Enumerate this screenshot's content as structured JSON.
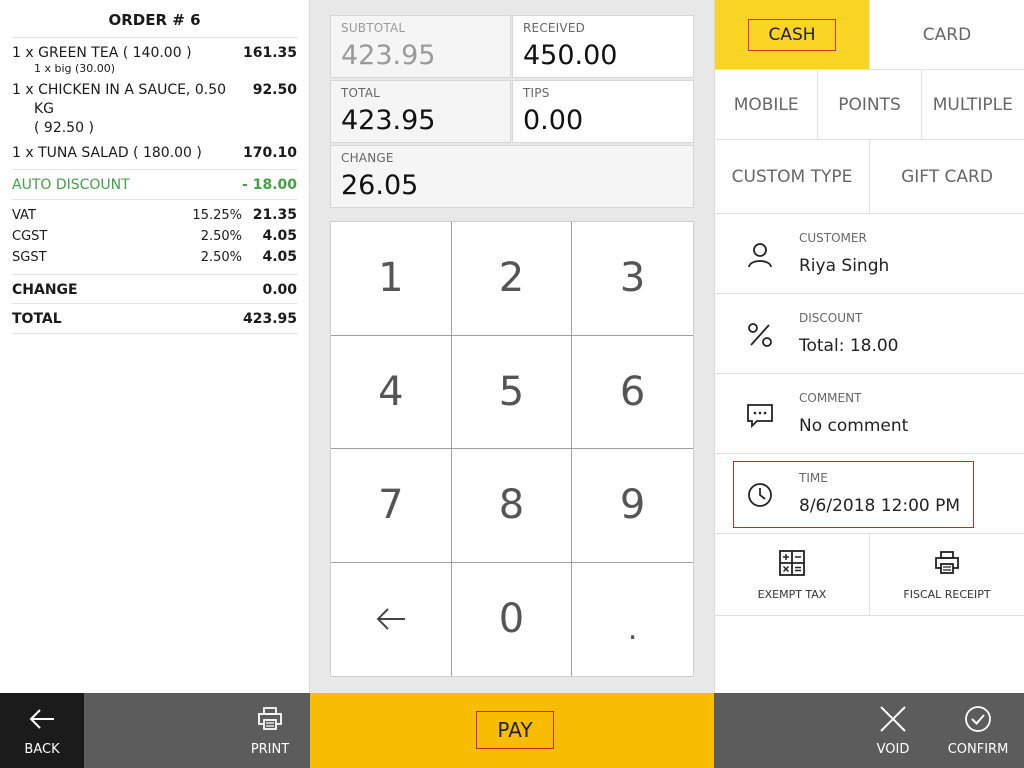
{
  "order": {
    "title": "ORDER # 6",
    "items": [
      {
        "qty": "1 x",
        "name": "GREEN TEA ( 140.00 )",
        "sub": "1 x big (30.00)",
        "amount": "161.35"
      },
      {
        "qty": "1 x",
        "name": "CHICKEN IN A SAUCE, 0.50",
        "name2": "KG",
        "name3": "( 92.50 )",
        "amount": "92.50"
      },
      {
        "qty": "1 x",
        "name": "TUNA SALAD ( 180.00 )",
        "amount": "170.10"
      }
    ],
    "discount": {
      "label": "AUTO DISCOUNT",
      "amount": "- 18.00"
    },
    "taxes": [
      {
        "name": "VAT",
        "pct": "15.25%",
        "value": "21.35"
      },
      {
        "name": "CGST",
        "pct": "2.50%",
        "value": "4.05"
      },
      {
        "name": "SGST",
        "pct": "2.50%",
        "value": "4.05"
      }
    ],
    "change": {
      "label": "CHANGE",
      "value": "0.00"
    },
    "total": {
      "label": "TOTAL",
      "value": "423.95"
    }
  },
  "amounts": {
    "subtotal": {
      "label": "SUBTOTAL",
      "value": "423.95"
    },
    "received": {
      "label": "RECEIVED",
      "value": "450.00"
    },
    "total": {
      "label": "TOTAL",
      "value": "423.95"
    },
    "tips": {
      "label": "TIPS",
      "value": "0.00"
    },
    "change": {
      "label": "CHANGE",
      "value": "26.05"
    }
  },
  "keypad": [
    "1",
    "2",
    "3",
    "4",
    "5",
    "6",
    "7",
    "8",
    "9",
    "0",
    "."
  ],
  "payment_types": {
    "cash": "CASH",
    "card": "CARD",
    "mobile": "MOBILE",
    "points": "POINTS",
    "multiple": "MULTIPLE",
    "custom_type": "CUSTOM TYPE",
    "gift_card": "GIFT CARD"
  },
  "info": {
    "customer": {
      "label": "CUSTOMER",
      "value": "Riya Singh"
    },
    "discount": {
      "label": "DISCOUNT",
      "value": "Total: 18.00"
    },
    "comment": {
      "label": "COMMENT",
      "value": "No comment"
    },
    "time": {
      "label": "TIME",
      "value": "8/6/2018 12:00 PM"
    }
  },
  "actions": {
    "exempt_tax": "EXEMPT TAX",
    "fiscal_receipt": "FISCAL RECEIPT"
  },
  "bottom": {
    "back": "BACK",
    "print": "PRINT",
    "pay": "PAY",
    "void": "VOID",
    "confirm": "CONFIRM"
  },
  "colors": {
    "accent_yellow": "#f9d423",
    "pay_bar": "#f9bd00",
    "discount_green": "#43a047",
    "highlight_red": "#c62828",
    "bar_dark": "#1b1b1b",
    "bar_gray": "#5c5c5c"
  }
}
